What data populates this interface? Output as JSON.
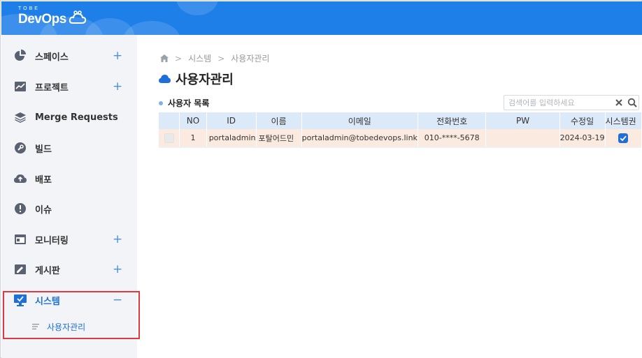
{
  "app": {
    "logo_small": "TOBE",
    "logo_main": "DevOps",
    "brand_color": "#1f7fe8",
    "accent_color": "#1f6fd9",
    "highlight_color": "#e0393e"
  },
  "sidebar": {
    "items": [
      {
        "label": "스페이스",
        "icon": "pie-chart-icon",
        "toggle": "+"
      },
      {
        "label": "프로젝트",
        "icon": "project-chart-icon",
        "toggle": "+"
      },
      {
        "label": "Merge Requests",
        "icon": "layers-icon",
        "toggle": ""
      },
      {
        "label": "빌드",
        "icon": "wrench-icon",
        "toggle": ""
      },
      {
        "label": "배포",
        "icon": "cloud-upload-icon",
        "toggle": ""
      },
      {
        "label": "이슈",
        "icon": "alert-icon",
        "toggle": ""
      },
      {
        "label": "모니터링",
        "icon": "monitor-window-icon",
        "toggle": "+"
      },
      {
        "label": "게시판",
        "icon": "board-icon",
        "toggle": "+"
      },
      {
        "label": "시스템",
        "icon": "system-monitor-icon",
        "toggle": "−",
        "active": true
      }
    ],
    "sub_items": [
      {
        "label": "사용자관리",
        "icon": "list-icon"
      }
    ]
  },
  "breadcrumb": {
    "home_icon": "home-icon",
    "items": [
      "시스템",
      "사용자관리"
    ]
  },
  "page": {
    "title": "사용자관리",
    "title_icon": "cloud-icon"
  },
  "user_list": {
    "title": "사용자 목록",
    "search": {
      "placeholder": "검색어를 입력하세요",
      "value": ""
    },
    "columns": [
      "",
      "NO",
      "ID",
      "이름",
      "이메일",
      "전화번호",
      "PW",
      "수정일",
      "시스템권"
    ],
    "rows": [
      {
        "checked": false,
        "no": "1",
        "id": "portaladmin",
        "name": "포탈어드민",
        "email": "portaladmin@tobedevops.link",
        "phone": "010-****-5678",
        "pw": "",
        "modified": "2024-03-19",
        "system_role": true
      }
    ]
  }
}
